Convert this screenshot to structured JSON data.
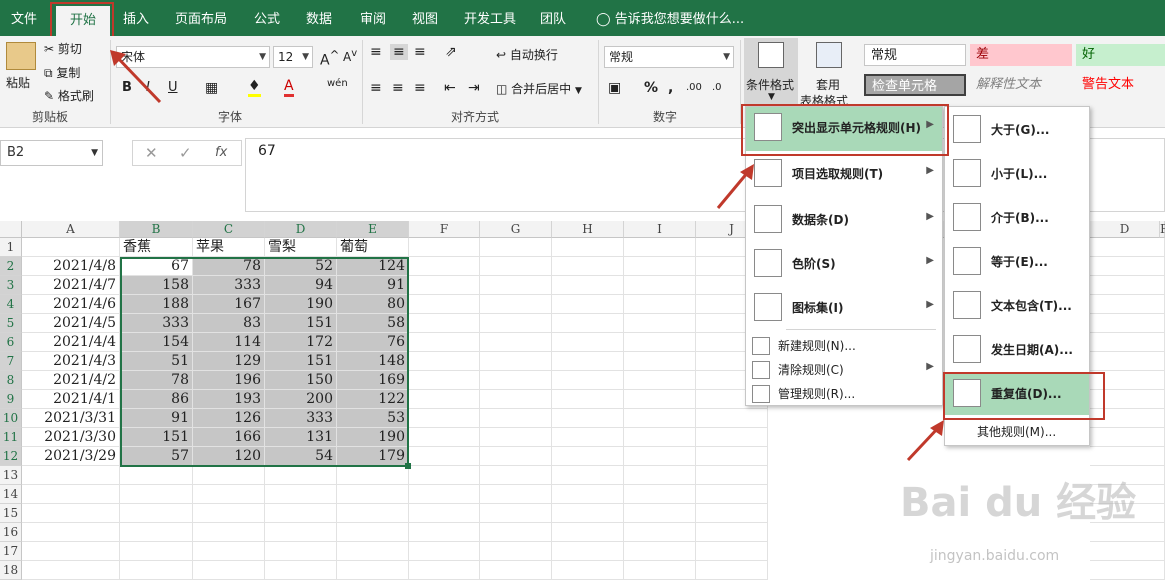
{
  "tabs": [
    "文件",
    "开始",
    "插入",
    "页面布局",
    "公式",
    "数据",
    "审阅",
    "视图",
    "开发工具",
    "团队"
  ],
  "tell_me": "告诉我您想要做什么...",
  "clipboard": {
    "paste": "粘贴",
    "cut": "剪切",
    "copy": "复制",
    "format_painter": "格式刷",
    "label": "剪贴板"
  },
  "font": {
    "name": "宋体",
    "size": "12",
    "label": "字体",
    "bold": "B",
    "italic": "I",
    "underline": "U"
  },
  "alignment": {
    "wrap": "自动换行",
    "merge": "合并后居中",
    "label": "对齐方式"
  },
  "number": {
    "format": "常规",
    "label": "数字",
    "percent": "%"
  },
  "styles": {
    "conditional": "条件格式",
    "table": "套用",
    "table2": "表格格式",
    "normal": "常规",
    "bad": "差",
    "good": "好",
    "check": "检查单元格",
    "explanatory": "解释性文本",
    "warning": "警告文本",
    "bad_color": "#ffc7ce",
    "good_color": "#c6efce"
  },
  "name_box": "B2",
  "formula_value": "67",
  "columns": [
    "A",
    "B",
    "C",
    "D",
    "E",
    "F",
    "G",
    "H",
    "I",
    "J"
  ],
  "right_columns": [
    "D",
    "F"
  ],
  "row_numbers": [
    "1",
    "2",
    "3",
    "4",
    "5",
    "6",
    "7",
    "8",
    "9",
    "10",
    "11",
    "12",
    "13",
    "14",
    "15",
    "16",
    "17",
    "18"
  ],
  "headers": [
    "",
    "香蕉",
    "苹果",
    "雪梨",
    "葡萄"
  ],
  "rows": [
    [
      "2021/4/8",
      "67",
      "78",
      "52",
      "124"
    ],
    [
      "2021/4/7",
      "158",
      "333",
      "94",
      "91"
    ],
    [
      "2021/4/6",
      "188",
      "167",
      "190",
      "80"
    ],
    [
      "2021/4/5",
      "333",
      "83",
      "151",
      "58"
    ],
    [
      "2021/4/4",
      "154",
      "114",
      "172",
      "76"
    ],
    [
      "2021/4/3",
      "51",
      "129",
      "151",
      "148"
    ],
    [
      "2021/4/2",
      "78",
      "196",
      "150",
      "169"
    ],
    [
      "2021/4/1",
      "86",
      "193",
      "200",
      "122"
    ],
    [
      "2021/3/31",
      "91",
      "126",
      "333",
      "53"
    ],
    [
      "2021/3/30",
      "151",
      "166",
      "131",
      "190"
    ],
    [
      "2021/3/29",
      "57",
      "120",
      "54",
      "179"
    ]
  ],
  "cf_menu": [
    {
      "label": "突出显示单元格规则(H)",
      "sub": true
    },
    {
      "label": "项目选取规则(T)",
      "sub": true
    },
    {
      "label": "数据条(D)",
      "sub": true
    },
    {
      "label": "色阶(S)",
      "sub": true
    },
    {
      "label": "图标集(I)",
      "sub": true
    },
    {
      "label": "新建规则(N)...",
      "sub": false
    },
    {
      "label": "清除规则(C)",
      "sub": true
    },
    {
      "label": "管理规则(R)...",
      "sub": false
    }
  ],
  "highlight_menu": [
    {
      "label": "大于(G)..."
    },
    {
      "label": "小于(L)..."
    },
    {
      "label": "介于(B)..."
    },
    {
      "label": "等于(E)..."
    },
    {
      "label": "文本包含(T)..."
    },
    {
      "label": "发生日期(A)..."
    },
    {
      "label": "重复值(D)..."
    },
    {
      "label": "其他规则(M)..."
    }
  ],
  "watermark": "Bai du 经验",
  "watermark_url": "jingyan.baidu.com",
  "accent": "#217346",
  "highlight_color": "#a9d9b8",
  "annotation_color": "#c0392b"
}
